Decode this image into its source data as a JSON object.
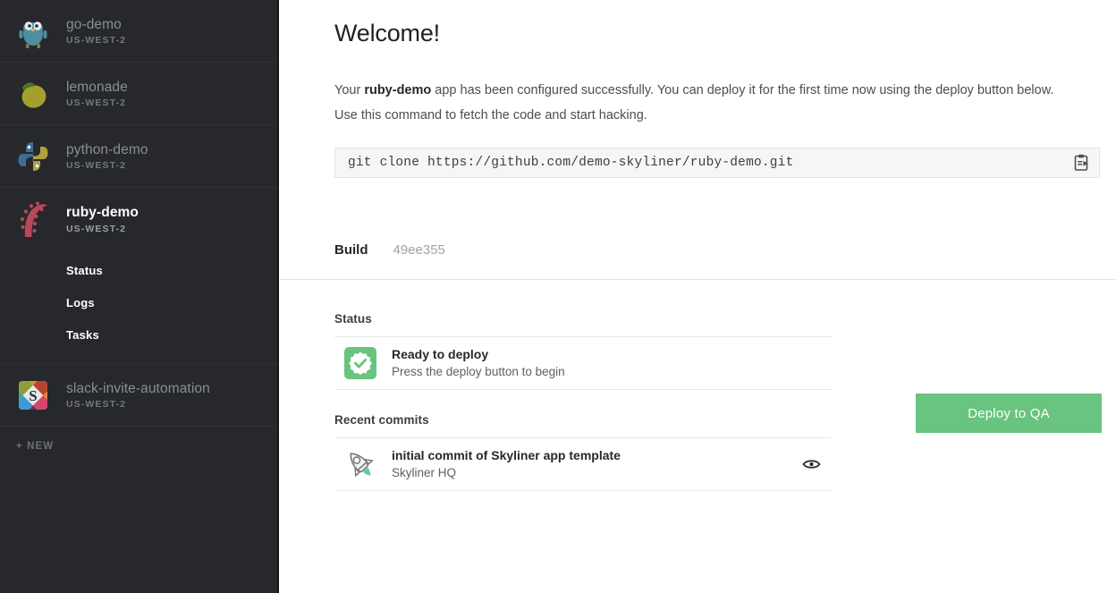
{
  "sidebar": {
    "apps": [
      {
        "name": "go-demo",
        "region": "US-WEST-2",
        "icon": "gopher-icon",
        "active": false
      },
      {
        "name": "lemonade",
        "region": "US-WEST-2",
        "icon": "lemon-icon",
        "active": false
      },
      {
        "name": "python-demo",
        "region": "US-WEST-2",
        "icon": "python-icon",
        "active": false
      },
      {
        "name": "ruby-demo",
        "region": "US-WEST-2",
        "icon": "ruby-icon",
        "active": true
      },
      {
        "name": "slack-invite-automation",
        "region": "US-WEST-2",
        "icon": "slack-icon",
        "active": false
      }
    ],
    "subnav": [
      {
        "label": "Status"
      },
      {
        "label": "Logs"
      },
      {
        "label": "Tasks"
      }
    ],
    "new_label": "+ NEW"
  },
  "main": {
    "title": "Welcome!",
    "intro_prefix": "Your ",
    "intro_app": "ruby-demo",
    "intro_suffix": " app has been configured successfully. You can deploy it for the first time now using the deploy button below. Use this command to fetch the code and start hacking.",
    "command": "git clone https://github.com/demo-skyliner/ruby-demo.git",
    "copy_icon": "clipboard-icon",
    "build_label": "Build",
    "build_sha": "49ee355",
    "status": {
      "heading": "Status",
      "icon": "check-badge-icon",
      "title": "Ready to deploy",
      "subtitle": "Press the deploy button to begin",
      "deploy_label": "Deploy to QA",
      "deploy_color": "#68c47e"
    },
    "commits": {
      "heading": "Recent commits",
      "items": [
        {
          "icon": "rocket-icon",
          "title": "initial commit of Skyliner app template",
          "author": "Skyliner HQ",
          "action_icon": "eye-icon"
        }
      ]
    }
  }
}
